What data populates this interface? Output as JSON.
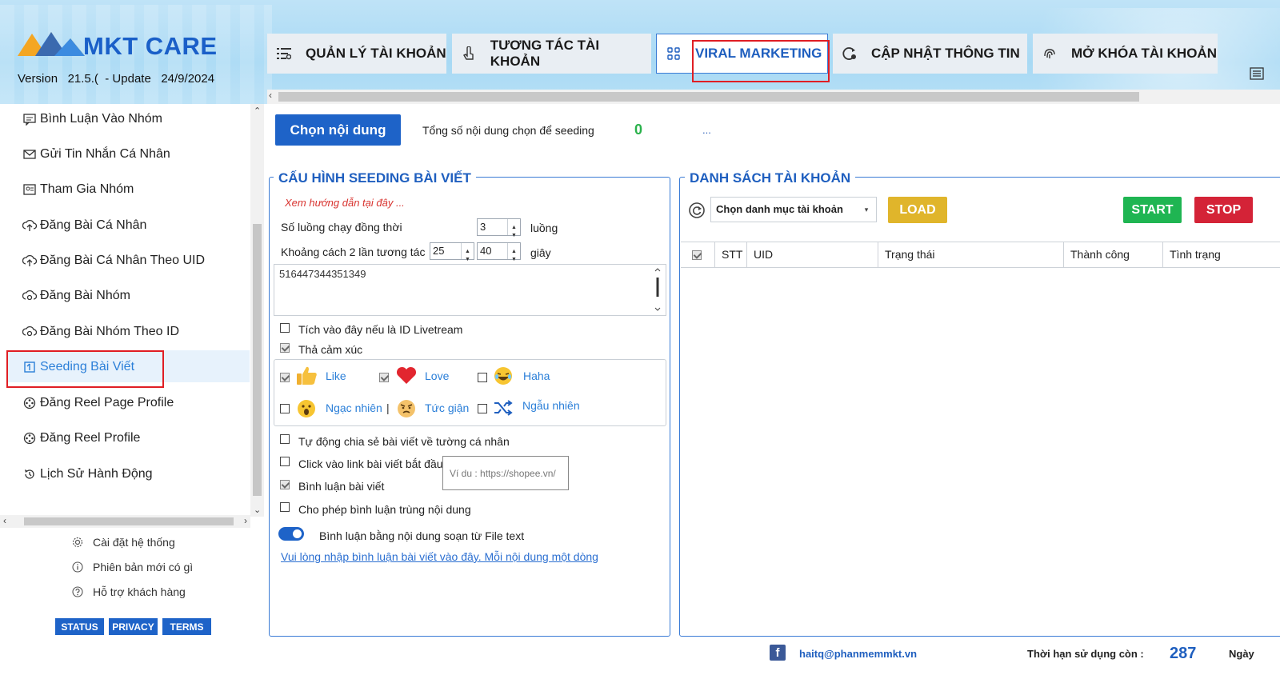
{
  "colors": {
    "primary": "#1e63c8",
    "accent_text": "#1f5fbf",
    "highlight_box": "#e01e24",
    "start": "#1fb552",
    "stop": "#d42337",
    "load": "#e0b52b",
    "count_green": "#2bb24c"
  },
  "app": {
    "logo_text": "MKT CARE",
    "version_label": "Version",
    "version_value": "21.5.(",
    "update_label": "- Update",
    "update_date": "24/9/2024"
  },
  "tabs": [
    {
      "label": "QUẢN LÝ TÀI KHOẢN",
      "icon": "list-icon"
    },
    {
      "label": "TƯƠNG TÁC TÀI KHOẢN",
      "icon": "touch-icon"
    },
    {
      "label": "VIRAL MARKETING",
      "icon": "apps-icon",
      "active": true
    },
    {
      "label": "CẬP NHẬT THÔNG TIN",
      "icon": "refresh-icon"
    },
    {
      "label": "MỞ KHÓA TÀI KHOẢN",
      "icon": "fingerprint-icon"
    }
  ],
  "sidebar": {
    "items": [
      {
        "label": "Bình Luận Vào Nhóm",
        "icon": "comment-icon"
      },
      {
        "label": "Gửi Tin Nhắn Cá Nhân",
        "icon": "message-icon"
      },
      {
        "label": "Tham Gia Nhóm",
        "icon": "group-icon"
      },
      {
        "label": "Đăng Bài Cá Nhân",
        "icon": "upload-icon"
      },
      {
        "label": "Đăng Bài Cá Nhân Theo UID",
        "icon": "upload-icon"
      },
      {
        "label": "Đăng Bài Nhóm",
        "icon": "share-icon"
      },
      {
        "label": "Đăng Bài Nhóm Theo ID",
        "icon": "share-icon"
      },
      {
        "label": "Seeding Bài Viết",
        "icon": "seeding-icon",
        "active": true
      },
      {
        "label": "Đăng Reel Page Profile",
        "icon": "reel-icon"
      },
      {
        "label": "Đăng Reel Profile",
        "icon": "reel-icon"
      },
      {
        "label": "Lịch Sử Hành Động",
        "icon": "history-icon"
      }
    ],
    "links": [
      {
        "label": "Cài đặt hệ thống",
        "icon": "gear-icon"
      },
      {
        "label": "Phiên bản mới có gì",
        "icon": "info-icon"
      },
      {
        "label": "Hỗ trợ khách hàng",
        "icon": "help-icon"
      }
    ],
    "buttons": {
      "status": "STATUS",
      "privacy": "PRIVACY",
      "terms": "TERMS"
    }
  },
  "content": {
    "choose_button": "Chọn nội dung",
    "total_label": "Tổng số nội dung chọn để seeding",
    "total_count": "0",
    "total_more": "..."
  },
  "config": {
    "title": "CẤU HÌNH SEEDING BÀI VIẾT",
    "guide_link": "Xem hướng dẫn tại đây ...",
    "threads_label": "Số luồng chạy đồng thời",
    "threads_value": "3",
    "threads_unit": "luồng",
    "interval_label": "Khoảng cách 2 lần tương tác",
    "interval_min": "25",
    "interval_max": "40",
    "interval_unit": "giây",
    "post_ids": "516447344351349",
    "livestream_label": "Tích vào đây nếu là ID Livetream",
    "livestream_checked": false,
    "react_label": "Thả cảm xúc",
    "react_checked": true,
    "reactions": [
      {
        "label": "Like",
        "icon": "like-icon",
        "checked": true
      },
      {
        "label": "Love",
        "icon": "heart-icon",
        "checked": true
      },
      {
        "label": "Haha",
        "icon": "laugh-icon",
        "checked": false
      },
      {
        "label": "Ngạc nhiên",
        "icon": "wow-icon",
        "checked": false
      },
      {
        "label": "Tức giận",
        "icon": "angry-icon",
        "checked": false
      },
      {
        "label": "Ngẫu nhiên",
        "icon": "shuffle-icon",
        "checked": false
      }
    ],
    "auto_share_label": "Tự động chia sẻ bài viết về tường cá nhân",
    "auto_share_checked": false,
    "click_link_label": "Click vào link bài viết bắt đầu",
    "click_link_checked": false,
    "click_link_placeholder": "Ví du : https://shopee.vn/",
    "comment_label": "Bình luận bài viết",
    "comment_checked": true,
    "dup_comment_label": "Cho phép bình luận trùng nội dung",
    "dup_comment_checked": false,
    "file_text_label": "Bình luận bằng nội dung soạn từ File text",
    "file_text_on": true,
    "comment_input_link": "Vui lòng nhập bình luận bài viết vào đây. Mỗi nội dung một dòng"
  },
  "accounts": {
    "title": "DANH SÁCH TÀI KHOẢN",
    "category_placeholder": "Chọn danh mục tài khoản",
    "load_button": "LOAD",
    "start_button": "START",
    "stop_button": "STOP",
    "columns": [
      "STT",
      "UID",
      "Trạng thái",
      "Thành công",
      "Tình trạng"
    ]
  },
  "footer": {
    "email": "haitq@phanmemmkt.vn",
    "expiry_label": "Thời hạn sử dụng còn :",
    "days": "287",
    "days_unit": "Ngày"
  }
}
